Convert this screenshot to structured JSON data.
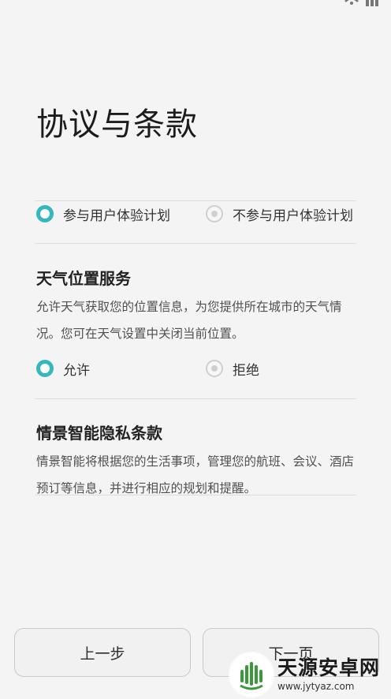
{
  "status_bar": {
    "icon": "wifi-signal-icon"
  },
  "page": {
    "title": "协议与条款"
  },
  "experience_plan": {
    "options": [
      {
        "label": "参与用户体验计划",
        "selected": true
      },
      {
        "label": "不参与用户体验计划",
        "selected": false
      }
    ]
  },
  "weather_location": {
    "title": "天气位置服务",
    "description": "允许天气获取您的位置信息，为您提供所在城市的天气情况。您可在天气设置中关闭当前位置。",
    "options": [
      {
        "label": "允许",
        "selected": true
      },
      {
        "label": "拒绝",
        "selected": false
      }
    ]
  },
  "smart_privacy": {
    "title": "情景智能隐私条款",
    "description": "情景智能将根据您的生活事项，管理您的航班、会议、酒店预订等信息，并进行相应的规划和提醒。"
  },
  "buttons": {
    "prev_label": "上一步",
    "next_label": "下一页"
  },
  "watermark": {
    "name": "天源安卓网",
    "url": "www.jytyaz.com"
  },
  "colors": {
    "accent": "#36b7c0",
    "background": "#f4f4f4",
    "divider": "#dcdcdc",
    "watermark_green": "#3a9a3a"
  }
}
